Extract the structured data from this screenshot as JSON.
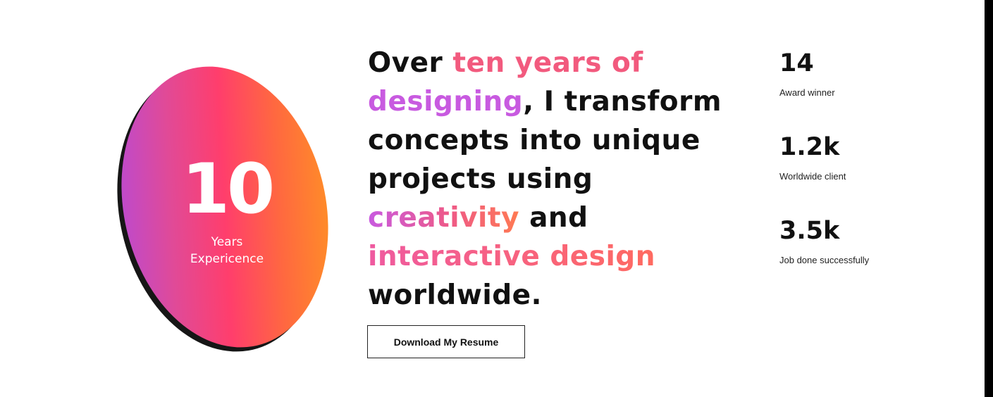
{
  "badge": {
    "number": "10",
    "label_line1": "Years",
    "label_line2": "Expericence"
  },
  "headline": {
    "w1": "Over",
    "w2": "ten years of",
    "w3": "designing",
    "w4": ", I transform",
    "w5": "concepts into unique",
    "w6": "projects using",
    "w7": "creativity",
    "w8": "and",
    "w9": "interactive design",
    "w10": "worldwide."
  },
  "resume_button": {
    "label": "Download My Resume"
  },
  "stats": [
    {
      "value": "14",
      "label": "Award winner"
    },
    {
      "value": "1.2k",
      "label": "Worldwide client"
    },
    {
      "value": "3.5k",
      "label": "Job done successfully"
    }
  ],
  "colors": {
    "accent_pink": "#f25a7e",
    "accent_purple": "#c85ae0",
    "accent_orange": "#ff9a1f",
    "text": "#111111"
  }
}
